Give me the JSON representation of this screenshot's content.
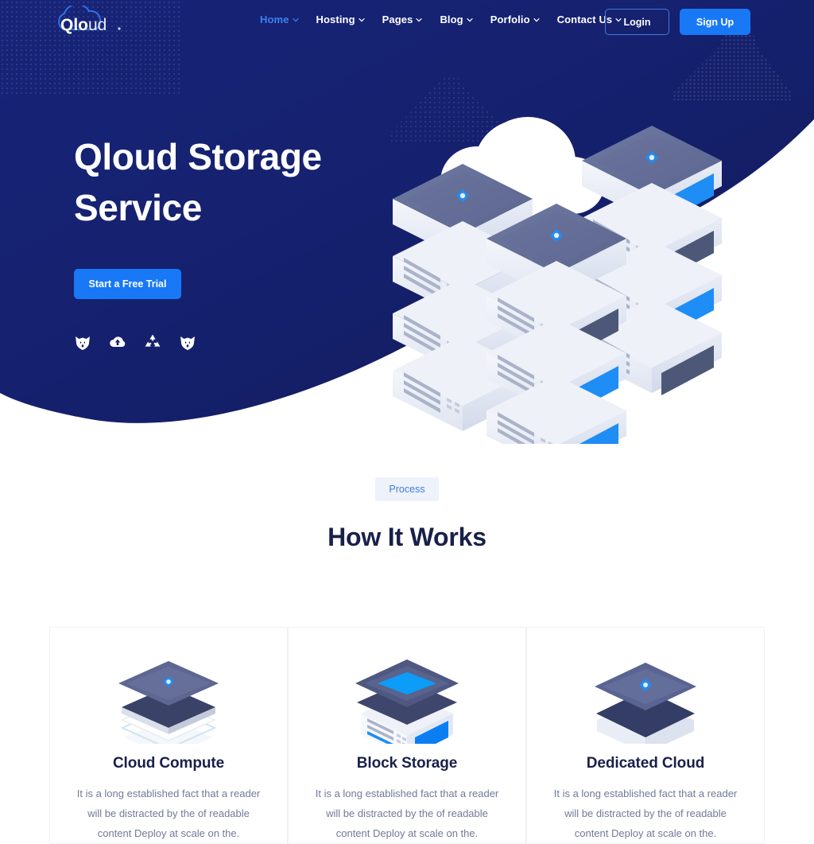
{
  "brand": {
    "logo_text_bold": "Qlo",
    "logo_text_light": "ud",
    "logo_name": "Qloud"
  },
  "colors": {
    "navy": "#16216b",
    "navy_deep": "#121c5e",
    "accent_blue": "#1878f6",
    "nav_active": "#3d80f0",
    "heading": "#19204a",
    "body_text": "#717b97",
    "badge_bg": "#eef2fb"
  },
  "nav": {
    "items": [
      {
        "label": "Home",
        "has_caret": true,
        "active": true
      },
      {
        "label": "Hosting",
        "has_caret": true,
        "active": false
      },
      {
        "label": "Pages",
        "has_caret": true,
        "active": false
      },
      {
        "label": "Blog",
        "has_caret": true,
        "active": false
      },
      {
        "label": "Porfolio",
        "has_caret": true,
        "active": false
      },
      {
        "label": "Contact Us",
        "has_caret": true,
        "active": false
      }
    ],
    "login_label": "Login",
    "signup_label": "Sign Up"
  },
  "hero": {
    "title_line1": "Qloud Storage",
    "title_line2": "Service",
    "cta_label": "Start a Free Trial",
    "brand_icons": [
      "fox-head-icon",
      "cloud-upload-icon",
      "recycle-icon",
      "fox-head-icon"
    ],
    "illustration": "isometric-server-rack-illustration"
  },
  "process": {
    "badge": "Process",
    "title": "How It Works",
    "cards": [
      {
        "icon": "stacked-layers-icon",
        "title": "Cloud Compute",
        "text": "It is a long established fact that a reader will be distracted by the of readable content Deploy at scale on the."
      },
      {
        "icon": "server-block-icon",
        "title": "Block Storage",
        "text": "It is a long established fact that a reader will be distracted by the of readable content Deploy at scale on the."
      },
      {
        "icon": "two-layer-stack-icon",
        "title": "Dedicated Cloud",
        "text": "It is a long established fact that a reader will be distracted by the of readable content Deploy at scale on the."
      }
    ]
  }
}
